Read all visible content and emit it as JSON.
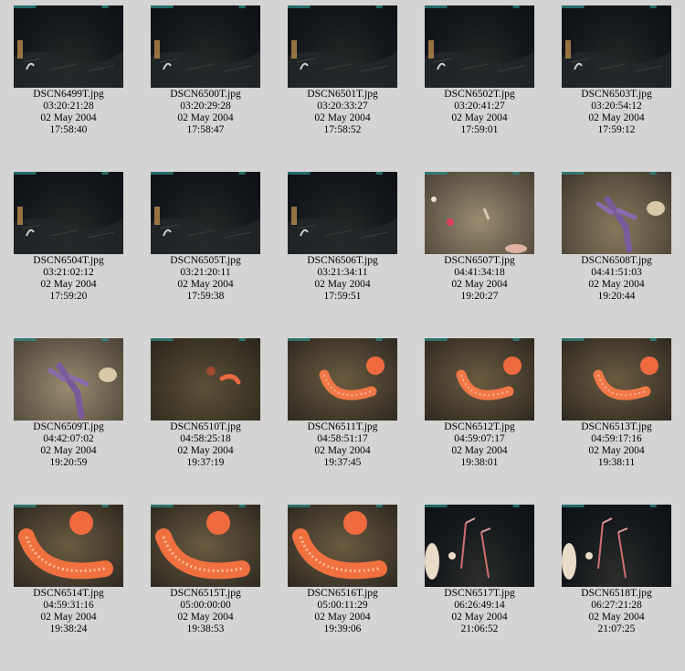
{
  "thumbnails": [
    {
      "file": "DSCN6499T.jpg",
      "timecode": "03:20:21:28",
      "date": "02 May 2004",
      "time": "17:58:40",
      "scene": "dark",
      "subject": "dark-seafloor"
    },
    {
      "file": "DSCN6500T.jpg",
      "timecode": "03:20:29:28",
      "date": "02 May 2004",
      "time": "17:58:47",
      "scene": "dark",
      "subject": "dark-seafloor"
    },
    {
      "file": "DSCN6501T.jpg",
      "timecode": "03:20:33:27",
      "date": "02 May 2004",
      "time": "17:58:52",
      "scene": "dark",
      "subject": "dark-seafloor"
    },
    {
      "file": "DSCN6502T.jpg",
      "timecode": "03:20:41:27",
      "date": "02 May 2004",
      "time": "17:59:01",
      "scene": "dark",
      "subject": "dark-seafloor"
    },
    {
      "file": "DSCN6503T.jpg",
      "timecode": "03:20:54:12",
      "date": "02 May 2004",
      "time": "17:59:12",
      "scene": "dark",
      "subject": "dark-seafloor"
    },
    {
      "file": "DSCN6504T.jpg",
      "timecode": "03:21:02:12",
      "date": "02 May 2004",
      "time": "17:59:20",
      "scene": "dark",
      "subject": "dark-seafloor"
    },
    {
      "file": "DSCN6505T.jpg",
      "timecode": "03:21:20:11",
      "date": "02 May 2004",
      "time": "17:59:38",
      "scene": "dark",
      "subject": "dark-seafloor"
    },
    {
      "file": "DSCN6506T.jpg",
      "timecode": "03:21:34:11",
      "date": "02 May 2004",
      "time": "17:59:51",
      "scene": "dark",
      "subject": "dark-seafloor"
    },
    {
      "file": "DSCN6507T.jpg",
      "timecode": "04:41:34:18",
      "date": "02 May 2004",
      "time": "19:20:27",
      "scene": "floor",
      "subject": "sea-floor-creatures"
    },
    {
      "file": "DSCN6508T.jpg",
      "timecode": "04:41:51:03",
      "date": "02 May 2004",
      "time": "19:20:44",
      "scene": "floor2",
      "subject": "purple-coral"
    },
    {
      "file": "DSCN6509T.jpg",
      "timecode": "04:42:07:02",
      "date": "02 May 2004",
      "time": "19:20:59",
      "scene": "floor",
      "subject": "purple-coral"
    },
    {
      "file": "DSCN6510T.jpg",
      "timecode": "04:58:25:18",
      "date": "02 May 2004",
      "time": "19:37:19",
      "scene": "mud",
      "subject": "small-worm"
    },
    {
      "file": "DSCN6511T.jpg",
      "timecode": "04:58:51:17",
      "date": "02 May 2004",
      "time": "19:37:45",
      "scene": "worm",
      "subject": "orange-worm"
    },
    {
      "file": "DSCN6512T.jpg",
      "timecode": "04:59:07:17",
      "date": "02 May 2004",
      "time": "19:38:01",
      "scene": "worm",
      "subject": "orange-worm"
    },
    {
      "file": "DSCN6513T.jpg",
      "timecode": "04:59:17:16",
      "date": "02 May 2004",
      "time": "19:38:11",
      "scene": "worm",
      "subject": "orange-worm"
    },
    {
      "file": "DSCN6514T.jpg",
      "timecode": "04:59:31:16",
      "date": "02 May 2004",
      "time": "19:38:24",
      "scene": "worm",
      "subject": "orange-worm-large"
    },
    {
      "file": "DSCN6515T.jpg",
      "timecode": "05:00:00:00",
      "date": "02 May 2004",
      "time": "19:38:53",
      "scene": "worm",
      "subject": "orange-worm-large"
    },
    {
      "file": "DSCN6516T.jpg",
      "timecode": "05:00:11:29",
      "date": "02 May 2004",
      "time": "19:39:06",
      "scene": "worm",
      "subject": "orange-worm-large"
    },
    {
      "file": "DSCN6517T.jpg",
      "timecode": "06:26:49:14",
      "date": "02 May 2004",
      "time": "21:06:52",
      "scene": "dark",
      "subject": "sea-pens"
    },
    {
      "file": "DSCN6518T.jpg",
      "timecode": "06:27:21:28",
      "date": "02 May 2004",
      "time": "21:07:25",
      "scene": "dark",
      "subject": "sea-pens"
    }
  ]
}
